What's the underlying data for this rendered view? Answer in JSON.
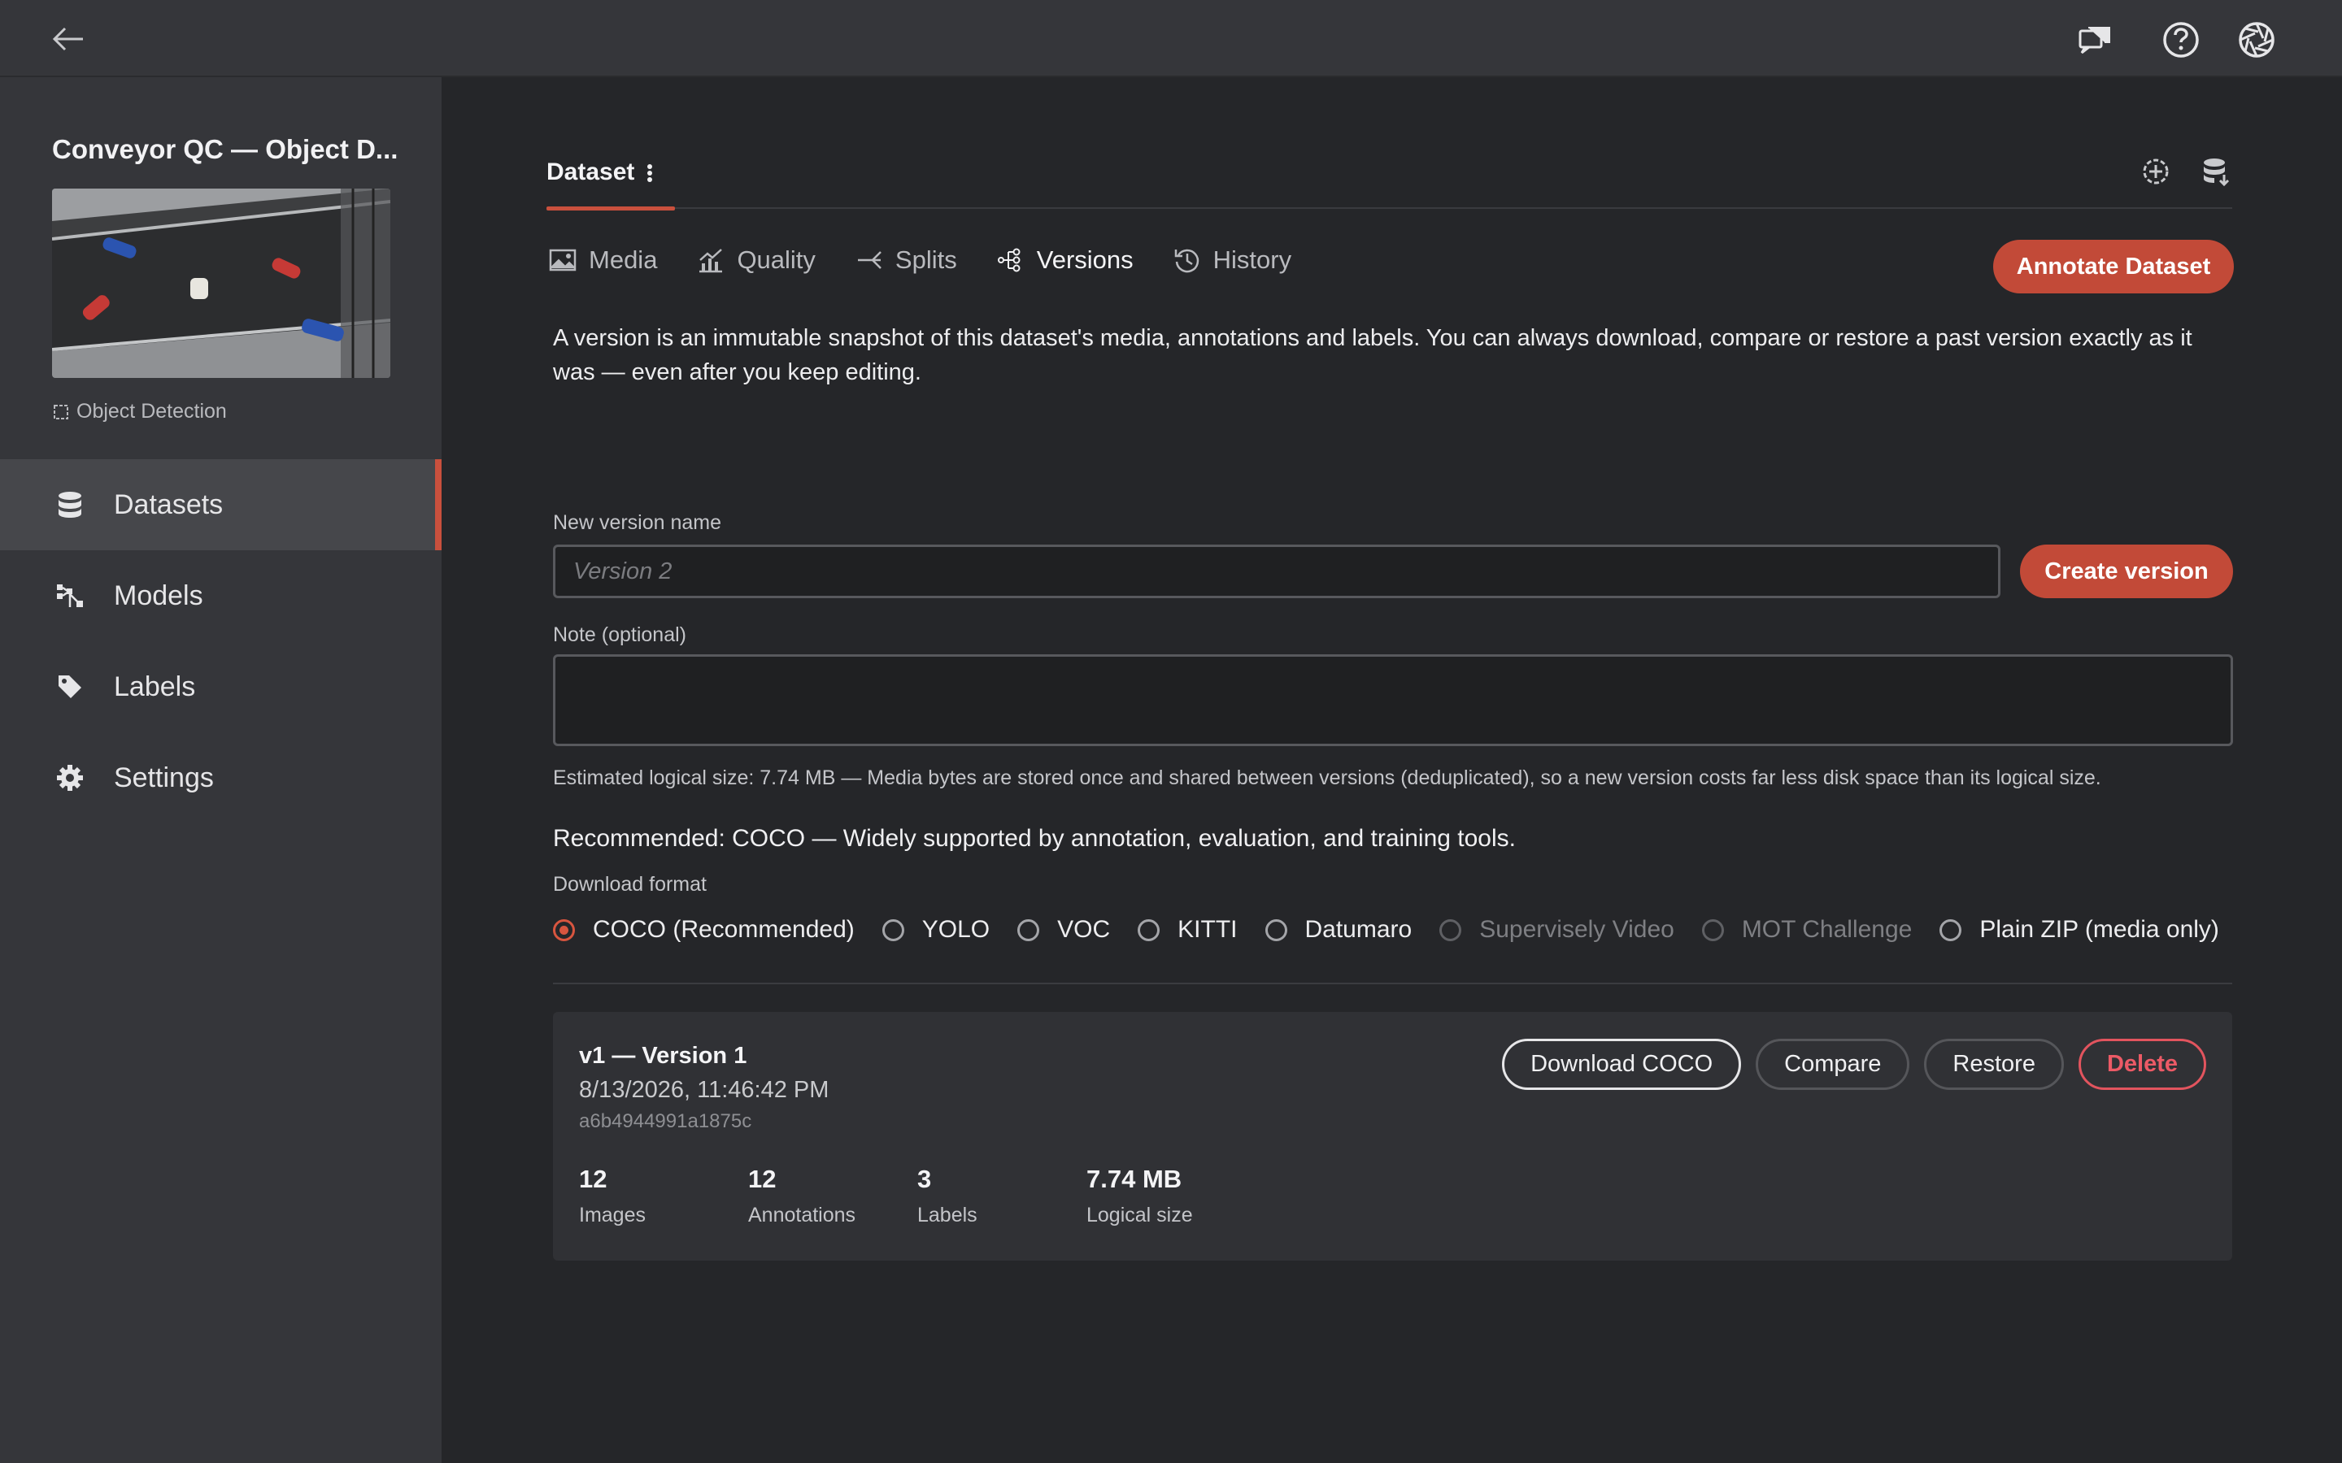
{
  "header": {
    "icons": [
      "back-arrow-icon",
      "chat-icon",
      "help-icon",
      "aperture-icon"
    ]
  },
  "sidebar": {
    "project_title": "Conveyor QC — Object D...",
    "project_type": "Object Detection",
    "items": [
      {
        "label": "Datasets",
        "icon": "database-icon",
        "active": true
      },
      {
        "label": "Models",
        "icon": "model-icon",
        "active": false
      },
      {
        "label": "Labels",
        "icon": "tag-icon",
        "active": false
      },
      {
        "label": "Settings",
        "icon": "gear-icon",
        "active": false
      }
    ]
  },
  "tabs": {
    "dataset_label": "Dataset"
  },
  "subtabs": [
    {
      "label": "Media",
      "icon": "image-icon"
    },
    {
      "label": "Quality",
      "icon": "chart-icon"
    },
    {
      "label": "Splits",
      "icon": "split-icon"
    },
    {
      "label": "Versions",
      "icon": "versions-icon",
      "active": true
    },
    {
      "label": "History",
      "icon": "history-icon"
    }
  ],
  "annotate_button": "Annotate Dataset",
  "description": "A version is an immutable snapshot of this dataset's media, annotations and labels. You can always download, compare or restore a past version exactly as it was — even after you keep editing.",
  "form": {
    "name_label": "New version name",
    "name_placeholder": "Version 2",
    "create_button": "Create version",
    "note_label": "Note (optional)",
    "note_value": ""
  },
  "hint": "Estimated logical size: 7.74 MB — Media bytes are stored once and shared between versions (deduplicated), so a new version costs far less disk space than its logical size.",
  "recommendation": "Recommended: COCO — Widely supported by annotation, evaluation, and training tools.",
  "format_label": "Download format",
  "formats": [
    {
      "label": "COCO (Recommended)",
      "selected": true,
      "disabled": false
    },
    {
      "label": "YOLO",
      "selected": false,
      "disabled": false
    },
    {
      "label": "VOC",
      "selected": false,
      "disabled": false
    },
    {
      "label": "KITTI",
      "selected": false,
      "disabled": false
    },
    {
      "label": "Datumaro",
      "selected": false,
      "disabled": false
    },
    {
      "label": "Supervisely Video",
      "selected": false,
      "disabled": true
    },
    {
      "label": "MOT Challenge",
      "selected": false,
      "disabled": true
    },
    {
      "label": "Plain ZIP (media only)",
      "selected": false,
      "disabled": false
    }
  ],
  "version": {
    "title": "v1 — Version 1",
    "date": "8/13/2026, 11:46:42 PM",
    "hash": "a6b4944991a1875c",
    "buttons": {
      "download": "Download COCO",
      "compare": "Compare",
      "restore": "Restore",
      "delete": "Delete"
    },
    "stats": [
      {
        "value": "12",
        "label": "Images"
      },
      {
        "value": "12",
        "label": "Annotations"
      },
      {
        "value": "3",
        "label": "Labels"
      },
      {
        "value": "7.74 MB",
        "label": "Logical size"
      }
    ]
  },
  "colors": {
    "accent": "#c24a38",
    "danger": "#e2545e",
    "background": "#252629",
    "sidebar": "#35363a"
  }
}
